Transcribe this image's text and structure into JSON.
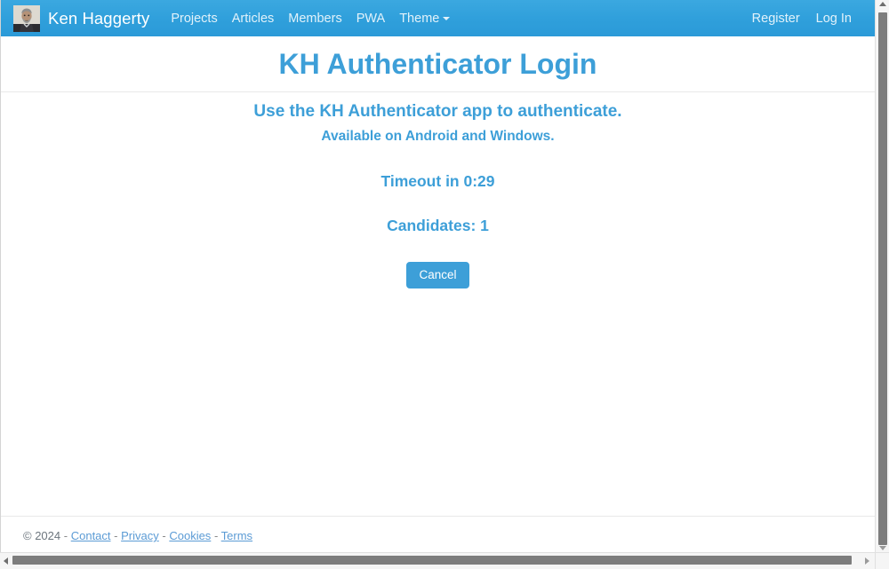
{
  "navbar": {
    "brand": {
      "name": "Ken Haggerty",
      "avatar_icon": "user-photo-avatar"
    },
    "links": [
      {
        "label": "Projects"
      },
      {
        "label": "Articles"
      },
      {
        "label": "Members"
      },
      {
        "label": "PWA"
      },
      {
        "label": "Theme",
        "has_caret": true,
        "caret_icon": "chevron-down-icon"
      }
    ],
    "right_links": [
      {
        "label": "Register"
      },
      {
        "label": "Log In"
      }
    ],
    "background_color": "#2f9fdb",
    "link_color": "#ffffff"
  },
  "main": {
    "title": "KH Authenticator Login",
    "lead_primary": "Use the KH Authenticator app to authenticate.",
    "lead_secondary": "Available on Android and Windows.",
    "timeout_text": "Timeout in 0:29",
    "candidates_text": "Candidates: 1",
    "cancel_label": "Cancel",
    "accent_color": "#3d9fd8"
  },
  "footer": {
    "copyright": "© 2024",
    "separator": "-",
    "links": [
      {
        "label": "Contact"
      },
      {
        "label": "Privacy"
      },
      {
        "label": "Cookies"
      },
      {
        "label": "Terms"
      }
    ]
  },
  "scrollbars": {
    "vertical_up_icon": "scroll-up-arrow-icon",
    "vertical_down_icon": "scroll-down-arrow-icon",
    "horizontal_left_icon": "scroll-left-arrow-icon",
    "horizontal_right_icon": "scroll-right-arrow-icon"
  }
}
